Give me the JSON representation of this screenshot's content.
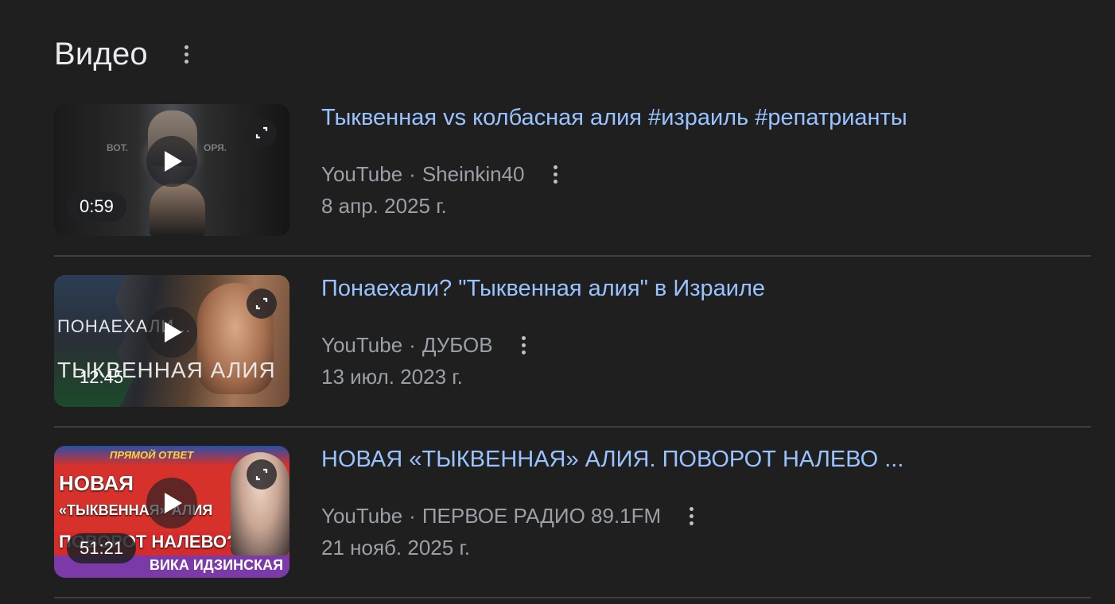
{
  "section": {
    "title": "Видео"
  },
  "videos": [
    {
      "title": "Тыквенная vs колбасная алия #израиль #репатрианты",
      "source": "YouTube",
      "separator": "·",
      "channel": "Sheinkin40",
      "date": "8 апр. 2025 г.",
      "duration": "0:59",
      "thumb_text": [
        "ВОТ.",
        "ОРЯ."
      ]
    },
    {
      "title": "Понаехали? \"Тыквенная алия\" в Израиле",
      "source": "YouTube",
      "separator": "·",
      "channel": "ДУБОВ",
      "date": "13 июл. 2023 г.",
      "duration": "12:45",
      "thumb_text": [
        "ПОНАЕХАЛИ...",
        "ТЫКВЕННАЯ АЛИЯ"
      ]
    },
    {
      "title": "НОВАЯ «ТЫКВЕННАЯ» АЛИЯ. ПОВОРОТ НАЛЕВО ...",
      "source": "YouTube",
      "separator": "·",
      "channel": "ПЕРВОЕ РАДИО 89.1FM",
      "date": "21 нояб. 2025 г.",
      "duration": "51:21",
      "thumb_text": [
        "ПРЯМОЙ ОТВЕТ",
        "НОВАЯ",
        "«ТЫКВЕННАЯ» АЛИЯ",
        "ПОВОРОТ НАЛЕВО?",
        "ВИКА ИДЗИНСКАЯ"
      ]
    }
  ],
  "colors": {
    "background": "#1f1f1f",
    "title_link": "#99c3ff",
    "meta_text": "#9aa0a6",
    "heading": "#e8eaed",
    "divider": "#3c4043"
  }
}
